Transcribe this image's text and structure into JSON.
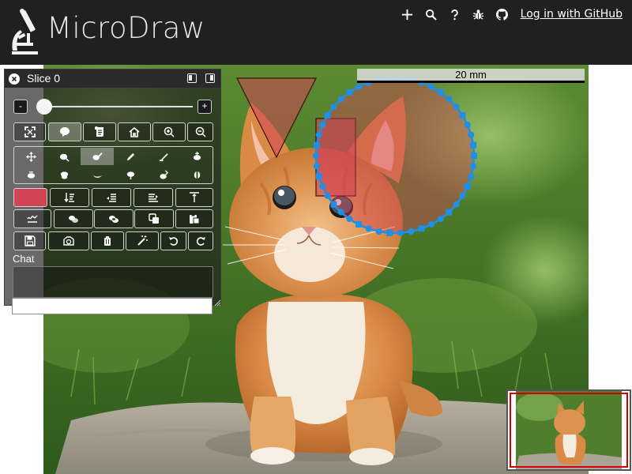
{
  "header": {
    "app_title": "MicroDraw",
    "login_label": "Log in with GitHub",
    "nav_icons": [
      "add-icon",
      "search-icon",
      "help-icon",
      "bug-icon",
      "github-icon"
    ]
  },
  "viewer": {
    "scale_bar_label": "20 mm"
  },
  "tools_panel": {
    "slice_title": "Slice 0",
    "zoom_minus": "-",
    "zoom_plus": "+",
    "zoom_level": 0.0,
    "chat_label": "Chat",
    "chat_input_placeholder": "",
    "selected_color": "#d24356"
  },
  "colors": {
    "header_bg": "#202020",
    "annotation_fill": "#d24356",
    "path_handle": "#1f8fe8",
    "navigator_region": "#d40000"
  }
}
